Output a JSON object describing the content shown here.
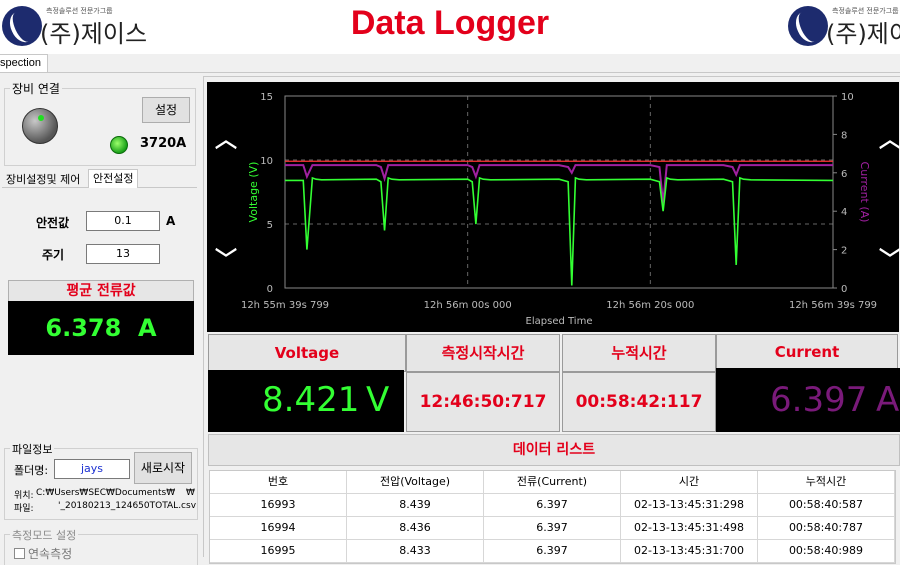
{
  "header": {
    "title": "Data Logger",
    "logo_tagline": "측정솔루션 전문가그룹",
    "logo_name": "(주)제이스"
  },
  "tabs": [
    {
      "label": "spection"
    }
  ],
  "device": {
    "group_label": "장비 연결",
    "settings_button": "설정",
    "model": "3720A"
  },
  "subtabs": [
    {
      "label": "장비설정및 제어"
    },
    {
      "label": "안전설정"
    }
  ],
  "safety": {
    "safe_value_label": "안전값",
    "safe_value": "0.1",
    "safe_unit": "A",
    "period_label": "주기",
    "period_value": "13"
  },
  "avg_current": {
    "title": "평균 전류값",
    "value": "6.378  A"
  },
  "file_info": {
    "group_label": "파일정보",
    "folder_label": "폴더명:",
    "folder_value": "jays",
    "new_start_button": "새로시작",
    "location_label": "위치:",
    "location_value": "C:₩Users₩SEC₩Documents₩",
    "location_suffix": "₩",
    "file_label": "파일:",
    "file_value": "'_20180213_124650TOTAL.csv"
  },
  "measure_mode": {
    "group_label": "측정모드 설정",
    "option_label": "연속측정"
  },
  "chart_data": {
    "type": "line",
    "xlabel": "Elapsed Time",
    "ylabel": "Voltage (V)",
    "y2label": "Current (A)",
    "x_ticks": [
      "12h 55m 39s 799",
      "12h 56m 00s 000",
      "12h 56m 20s 000",
      "12h 56m 39s 799"
    ],
    "ylim": [
      0,
      15
    ],
    "y_ticks": [
      0,
      5,
      10,
      15
    ],
    "y2lim": [
      0,
      10
    ],
    "y2_ticks": [
      0,
      2,
      4,
      6,
      8,
      10
    ],
    "grid": true,
    "colors": {
      "voltage": "#33ff33",
      "current": "#a020a0",
      "threshold": "#ff3333"
    },
    "x": [
      0,
      2,
      2.4,
      3,
      3.4,
      4,
      10,
      10.5,
      10.9,
      11.3,
      11.7,
      12.5,
      20,
      20.5,
      20.9,
      21.3,
      21.7,
      22.5,
      30,
      31,
      31.4,
      31.8,
      32.2,
      33,
      40,
      41,
      41.4,
      41.8,
      42.2,
      43,
      48,
      49,
      49.4,
      49.8,
      50.2,
      51,
      60
    ],
    "series": [
      {
        "name": "Voltage (V)",
        "axis": "left",
        "values": [
          8.4,
          8.4,
          3.0,
          8.6,
          8.5,
          8.45,
          8.5,
          8.3,
          4.5,
          8.6,
          8.5,
          8.45,
          8.5,
          8.3,
          5.0,
          8.6,
          8.5,
          8.45,
          8.5,
          8.3,
          0.2,
          8.6,
          8.5,
          8.45,
          8.5,
          8.3,
          6.0,
          8.6,
          8.5,
          8.45,
          8.5,
          8.3,
          1.8,
          8.6,
          8.5,
          8.45,
          8.4
        ]
      },
      {
        "name": "Current (A)",
        "axis": "right",
        "values": [
          6.4,
          6.4,
          5.8,
          6.4,
          6.4,
          6.4,
          6.4,
          6.3,
          5.7,
          6.4,
          6.4,
          6.4,
          6.4,
          6.3,
          5.8,
          6.4,
          6.4,
          6.4,
          6.4,
          6.3,
          6.0,
          6.4,
          6.4,
          6.4,
          6.4,
          6.3,
          4.4,
          6.4,
          6.4,
          6.4,
          6.4,
          6.3,
          5.9,
          6.4,
          6.4,
          6.4,
          6.4
        ]
      }
    ],
    "threshold_current": 6.6
  },
  "readouts": {
    "voltage_title": "Voltage",
    "voltage_value": "8.421",
    "voltage_unit": "V",
    "start_time_title": "측정시작시간",
    "start_time_value": "12:46:50:717",
    "elapsed_title": "누적시간",
    "elapsed_value": "00:58:42:117",
    "current_title": "Current",
    "current_value": "6.397",
    "current_unit": "A"
  },
  "data_list": {
    "title": "데이터 리스트",
    "columns": [
      "번호",
      "전압(Voltage)",
      "전류(Current)",
      "시간",
      "누적시간"
    ],
    "rows": [
      [
        "16993",
        "8.439",
        "6.397",
        "02-13-13:45:31:298",
        "00:58:40:587"
      ],
      [
        "16994",
        "8.436",
        "6.397",
        "02-13-13:45:31:498",
        "00:58:40:787"
      ],
      [
        "16995",
        "8.433",
        "6.397",
        "02-13-13:45:31:700",
        "00:58:40:989"
      ]
    ]
  }
}
